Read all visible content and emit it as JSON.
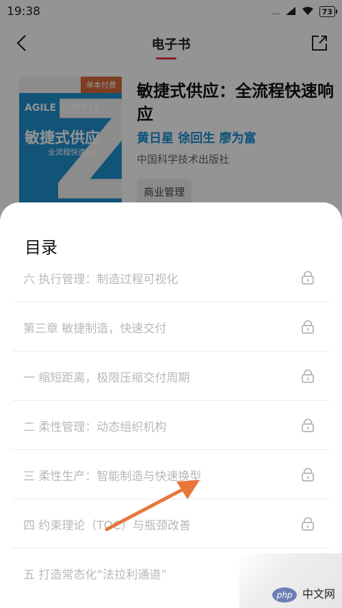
{
  "status_bar": {
    "time": "19:38",
    "dots": "...",
    "battery": "73"
  },
  "nav": {
    "title": "电子书"
  },
  "book": {
    "badge": "单本付费",
    "cover_en": "AGILE SUPPLY",
    "cover_cn": "敏捷式供应",
    "cover_sub": "全流程快速响应",
    "title": "敏捷式供应：全流程快速响应",
    "authors": "黄日星 徐回生 廖为富",
    "publisher": "中国科学技术出版社",
    "category": "商业管理"
  },
  "toc": {
    "title": "目录",
    "items": [
      {
        "label": "六 执行管理：制造过程可视化"
      },
      {
        "label": "第三章 敏捷制造，快速交付"
      },
      {
        "label": "一 缩短距离，极限压缩交付周期"
      },
      {
        "label": "二 柔性管理：动态组织机构"
      },
      {
        "label": "三 柔性生产：智能制造与快速换型"
      },
      {
        "label": "四 约束理论（TOC）与瓶颈改善"
      },
      {
        "label": "五 打造常态化“法拉利通道”"
      }
    ]
  },
  "watermark": {
    "logo": "php",
    "text": "中文网"
  },
  "colors": {
    "accent_red": "#e5373e",
    "author_blue": "#1b8ed6",
    "arrow_orange": "#e8763a"
  }
}
